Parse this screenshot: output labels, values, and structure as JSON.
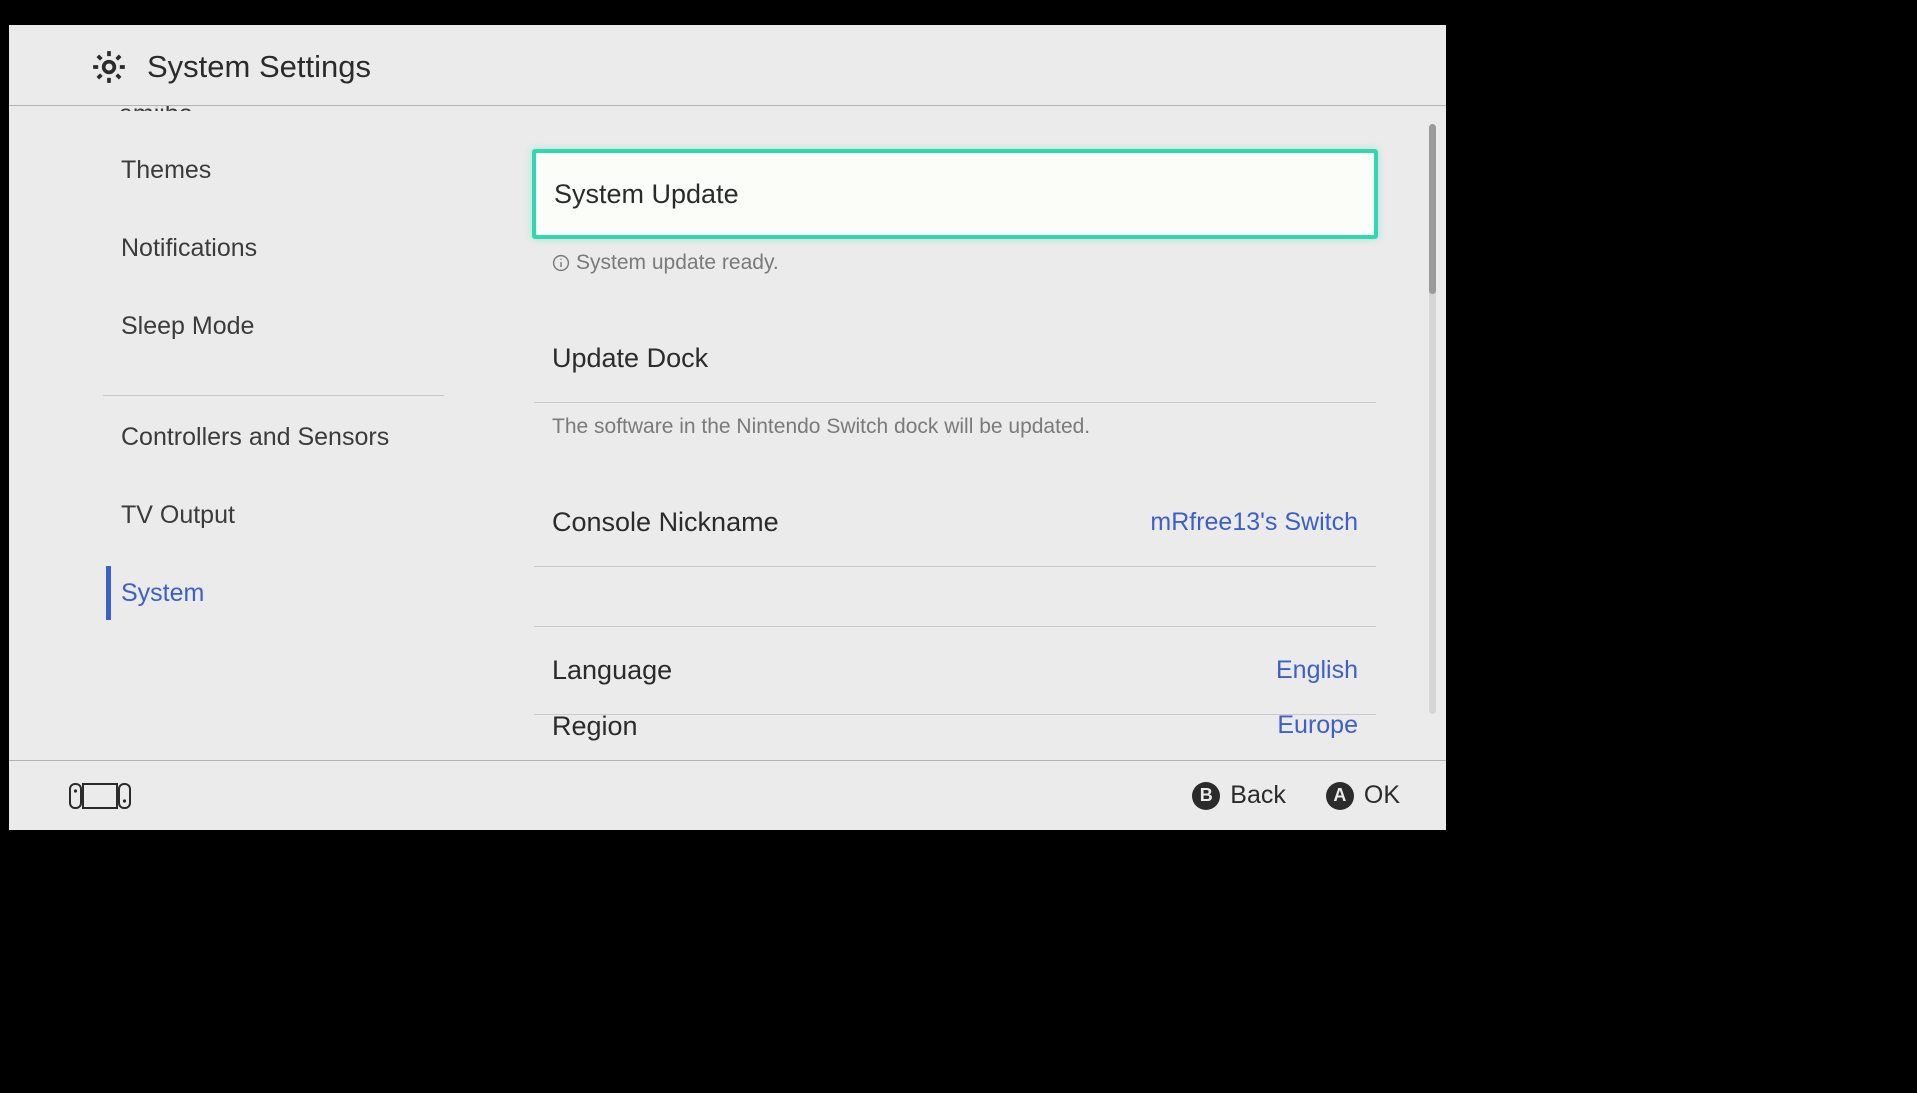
{
  "header": {
    "title": "System Settings"
  },
  "sidebar": {
    "cutoff_item": "amiibo",
    "group1": [
      "Themes",
      "Notifications",
      "Sleep Mode"
    ],
    "group2": [
      "Controllers and Sensors",
      "TV Output",
      "System"
    ],
    "active_index": 2
  },
  "main": {
    "items": [
      {
        "label": "System Update",
        "sub_icon": true,
        "sub": "System update ready.",
        "value": "",
        "selected": true
      },
      {
        "label": "Update Dock",
        "sub": "The software in the Nintendo Switch dock will be updated.",
        "value": ""
      },
      {
        "label": "Console Nickname",
        "value": "mRfree13's Switch"
      },
      {
        "label": "Language",
        "value": "English"
      },
      {
        "label": "Region",
        "value": "Europe",
        "cutoff": true
      }
    ]
  },
  "footer": {
    "back": {
      "letter": "B",
      "label": "Back"
    },
    "ok": {
      "letter": "A",
      "label": "OK"
    }
  }
}
